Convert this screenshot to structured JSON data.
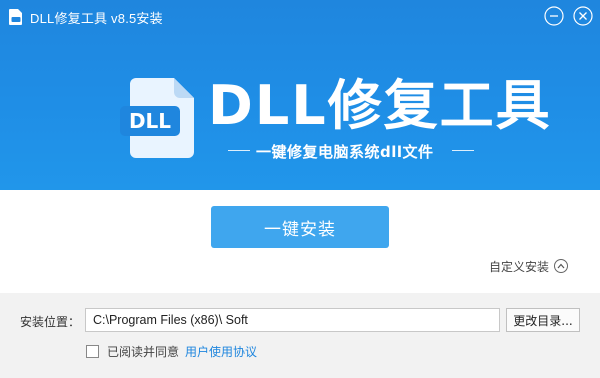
{
  "window": {
    "title": "DLL修复工具 v8.5安装",
    "minimize_icon": "minimize-icon",
    "close_icon": "close-icon"
  },
  "banner": {
    "logo_icon_text": "DLL",
    "logo_title": "DLL修复工具",
    "subtitle": "一键修复电脑系统dll文件",
    "background_color": "#1f8ee6"
  },
  "main": {
    "install_button": "一键安装",
    "custom_install": "自定义安装",
    "custom_install_icon": "chevron-up-icon",
    "accent_color": "#3fa6ee"
  },
  "footer": {
    "location_label": "安装位置：",
    "install_path": "C:\\Program Files (x86)\\ Soft",
    "change_dir_button": "更改目录...",
    "agree_text": "已阅读并同意",
    "agreement_link": "用户使用协议",
    "agree_checked": false
  }
}
